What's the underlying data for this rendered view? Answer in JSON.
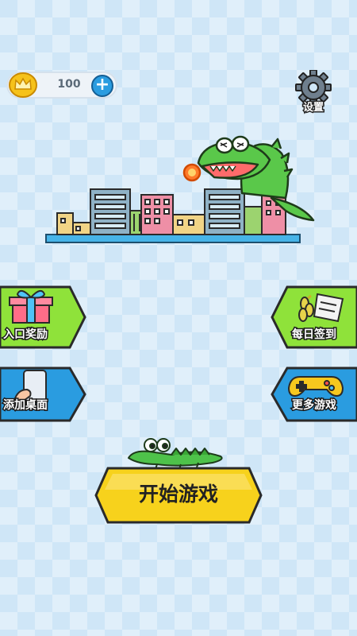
{
  "coins": {
    "count": "100",
    "add_symbol": "+"
  },
  "settings": {
    "label": "设置"
  },
  "menu": {
    "entry_reward": "入口奖励",
    "daily_checkin": "每日签到",
    "add_desktop": "添加桌面",
    "more_games": "更多游戏"
  },
  "start": {
    "label": "开始游戏"
  },
  "icons": {
    "coin": "crown-coin-icon",
    "settings": "gear-icon",
    "entry_reward": "gift-icon",
    "daily_checkin": "laurel-scroll-icon",
    "add_desktop": "phone-tap-icon",
    "more_games": "gamepad-icon"
  },
  "colors": {
    "background": "#cfe6f7",
    "button_green": "#8fe23a",
    "button_blue": "#2a9ce0",
    "start_yellow": "#f7d21c",
    "crocodile_green": "#5ac84a"
  }
}
